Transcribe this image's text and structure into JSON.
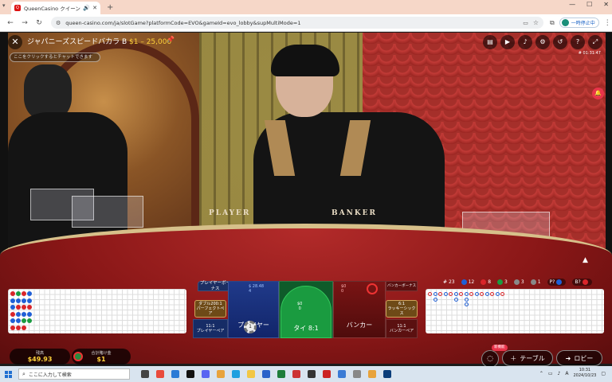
{
  "browser": {
    "tab_title": "QueenCasino クイーンカジノ",
    "tab_favicon": "Q",
    "url": "queen-casino.com/ja/slotGame?platformCode=EVO&gameId=evo_lobby&supMultiMode=1",
    "profile_label": "一時停止中",
    "icons": [
      "back-icon",
      "forward-icon",
      "reload-icon",
      "site-settings-icon",
      "cast-icon",
      "bookmark-star-icon",
      "extensions-icon",
      "menu-icon"
    ]
  },
  "game": {
    "title": "ジャパニーズスピードバカラ B",
    "limits": "$1 – 25,000",
    "chat_placeholder": "ここをクリックするとチャットできます",
    "round_id": "# 01:31:47",
    "table_player_label": "PLAYER",
    "table_banker_label": "BANKER",
    "top_icons": [
      "chat-icon",
      "video-icon",
      "volume-icon",
      "settings-icon",
      "history-icon",
      "help-icon",
      "fullscreen-icon"
    ],
    "notification_icon": "bell-icon"
  },
  "stats": {
    "round": "23",
    "player_wins": "12",
    "banker_wins": "8",
    "ties": "3",
    "player_pairs": "3",
    "banker_pairs": "1",
    "p_label": "P?",
    "b_label": "B?"
  },
  "board": {
    "player_bonus": "プレイヤーボーナス",
    "dragon_line1": "ダブル200:1",
    "dragon_line2": "パーフェクトペア",
    "player_pair_odds": "11:1",
    "player_pair": "プレイヤーペア",
    "player": "プレイヤー",
    "player_total": "$ 28.48",
    "player_count": "4",
    "tie": "タイ 8:1",
    "tie_total": "$0",
    "tie_count": "0",
    "banker": "バンカー",
    "banker_total": "$0",
    "banker_count": "0",
    "banker_bonus": "バンカーボーナス",
    "lucky6_odds": "6:1",
    "lucky6": "ラッキーシックス",
    "banker_pair_odds": "11:1",
    "banker_pair": "バンカーペア",
    "chip_value": "1"
  },
  "footer": {
    "balance_label": "残高",
    "balance": "$49.93",
    "total_bet_label": "合計賭け金",
    "total_bet": "$1",
    "new_badge": "新機能",
    "table_button": "テーブル",
    "lobby_button": "ロビー"
  },
  "taskbar": {
    "search_placeholder": "ここに入力して検索",
    "time": "10:31",
    "date": "2024/10/23",
    "ime": "A"
  },
  "colors": {
    "player": "#1f5fd6",
    "banker": "#d9252a",
    "tie": "#1a9b40",
    "accent": "#ffd23b"
  }
}
